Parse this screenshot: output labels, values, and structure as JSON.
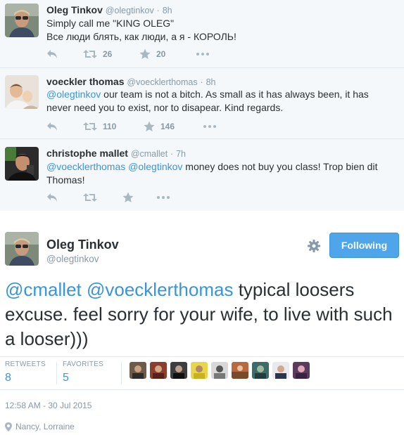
{
  "thread": [
    {
      "name": "Oleg Tinkov",
      "handle": "@olegtinkov",
      "time": "8h",
      "lines": [
        "Simply call me \"KING OLEG\"",
        "Все люди блять, как люди, а я - КОРОЛЬ!"
      ],
      "retweets": "26",
      "favorites": "20"
    },
    {
      "name": "voeckler thomas",
      "handle": "@voecklerthomas",
      "time": "8h",
      "mention": "@olegtinkov",
      "text": " our team is not a bitch. As small as it has always been, it has never need you to exist, nor to disapear. Kind regards.",
      "retweets": "110",
      "favorites": "146"
    },
    {
      "name": "christophe mallet",
      "handle": "@cmallet",
      "time": "7h",
      "mention1": "@voecklerthomas",
      "mention2": "@olegtinkov",
      "text": " money does not buy you class! Trop bien dit Thomas!"
    }
  ],
  "main": {
    "name": "Oleg Tinkov",
    "handle": "@olegtinkov",
    "follow_label": "Following",
    "mention1": "@cmallet",
    "mention2": "@voecklerthomas",
    "text": " typical loosers excuse. feel sorry for your wife, to live with such a looser)))",
    "retweets_label": "RETWEETS",
    "retweets": "8",
    "favorites_label": "FAVORITES",
    "favorites": "5",
    "timestamp": "12:58 AM - 30 Jul 2015",
    "location": "Nancy, Lorraine"
  },
  "colors": {
    "accent": "#3b94d9",
    "button": "#4ea5e9",
    "muted": "#8899a6",
    "thread_bg": "#f5f8fa"
  },
  "icons": [
    "reply-icon",
    "retweet-icon",
    "favorite-icon",
    "more-icon",
    "gear-icon",
    "location-pin-icon"
  ]
}
